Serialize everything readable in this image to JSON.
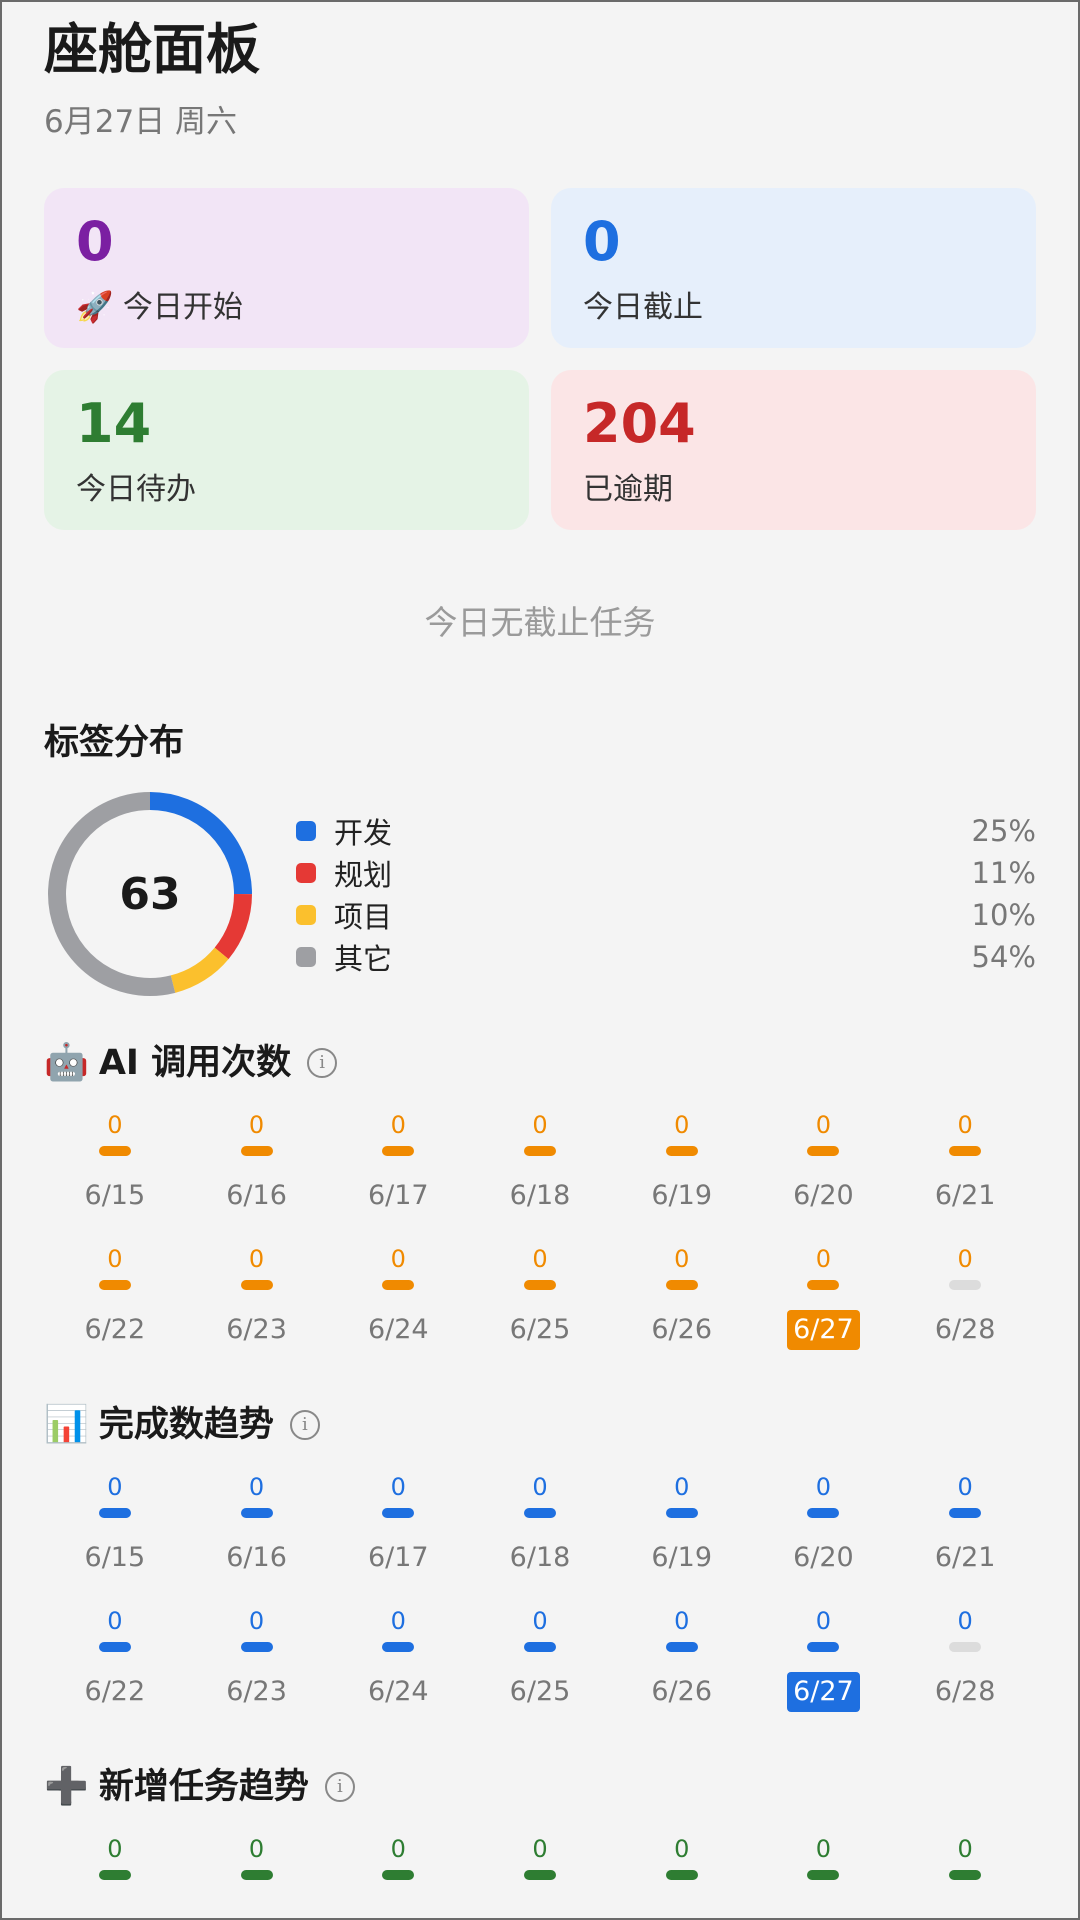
{
  "header": {
    "title": "座舱面板",
    "date": "6月27日 周六"
  },
  "stats": {
    "start": {
      "value": "0",
      "emoji": "🚀",
      "label": "今日开始"
    },
    "deadline": {
      "value": "0",
      "label": "今日截止"
    },
    "todo": {
      "value": "14",
      "label": "今日待办"
    },
    "overdue": {
      "value": "204",
      "label": "已逾期"
    }
  },
  "empty_message": "今日无截止任务",
  "tags": {
    "title": "标签分布",
    "total": "63",
    "items": [
      {
        "name": "开发",
        "pct": "25%",
        "value": 25,
        "color": "#1e6fe0"
      },
      {
        "name": "规划",
        "pct": "11%",
        "value": 11,
        "color": "#e53935"
      },
      {
        "name": "项目",
        "pct": "10%",
        "value": 10,
        "color": "#fbc02d"
      },
      {
        "name": "其它",
        "pct": "54%",
        "value": 54,
        "color": "#9e9fa3"
      }
    ]
  },
  "ai_calls": {
    "emoji": "🤖",
    "title": "AI 调用次数",
    "info_icon": "i",
    "days": [
      {
        "date": "6/15",
        "value": "0"
      },
      {
        "date": "6/16",
        "value": "0"
      },
      {
        "date": "6/17",
        "value": "0"
      },
      {
        "date": "6/18",
        "value": "0"
      },
      {
        "date": "6/19",
        "value": "0"
      },
      {
        "date": "6/20",
        "value": "0"
      },
      {
        "date": "6/21",
        "value": "0"
      },
      {
        "date": "6/22",
        "value": "0"
      },
      {
        "date": "6/23",
        "value": "0"
      },
      {
        "date": "6/24",
        "value": "0"
      },
      {
        "date": "6/25",
        "value": "0"
      },
      {
        "date": "6/26",
        "value": "0"
      },
      {
        "date": "6/27",
        "value": "0",
        "today": true
      },
      {
        "date": "6/28",
        "value": "0",
        "future": true
      }
    ]
  },
  "completed": {
    "emoji": "📊",
    "title": "完成数趋势",
    "info_icon": "i",
    "days": [
      {
        "date": "6/15",
        "value": "0"
      },
      {
        "date": "6/16",
        "value": "0"
      },
      {
        "date": "6/17",
        "value": "0"
      },
      {
        "date": "6/18",
        "value": "0"
      },
      {
        "date": "6/19",
        "value": "0"
      },
      {
        "date": "6/20",
        "value": "0"
      },
      {
        "date": "6/21",
        "value": "0"
      },
      {
        "date": "6/22",
        "value": "0"
      },
      {
        "date": "6/23",
        "value": "0"
      },
      {
        "date": "6/24",
        "value": "0"
      },
      {
        "date": "6/25",
        "value": "0"
      },
      {
        "date": "6/26",
        "value": "0"
      },
      {
        "date": "6/27",
        "value": "0",
        "today": true
      },
      {
        "date": "6/28",
        "value": "0",
        "future": true
      }
    ]
  },
  "new_tasks": {
    "emoji": "➕",
    "title": "新增任务趋势",
    "info_icon": "i",
    "days": [
      {
        "value": "0"
      },
      {
        "value": "0"
      },
      {
        "value": "0"
      },
      {
        "value": "0"
      },
      {
        "value": "0"
      },
      {
        "value": "0"
      },
      {
        "value": "0"
      }
    ]
  }
}
